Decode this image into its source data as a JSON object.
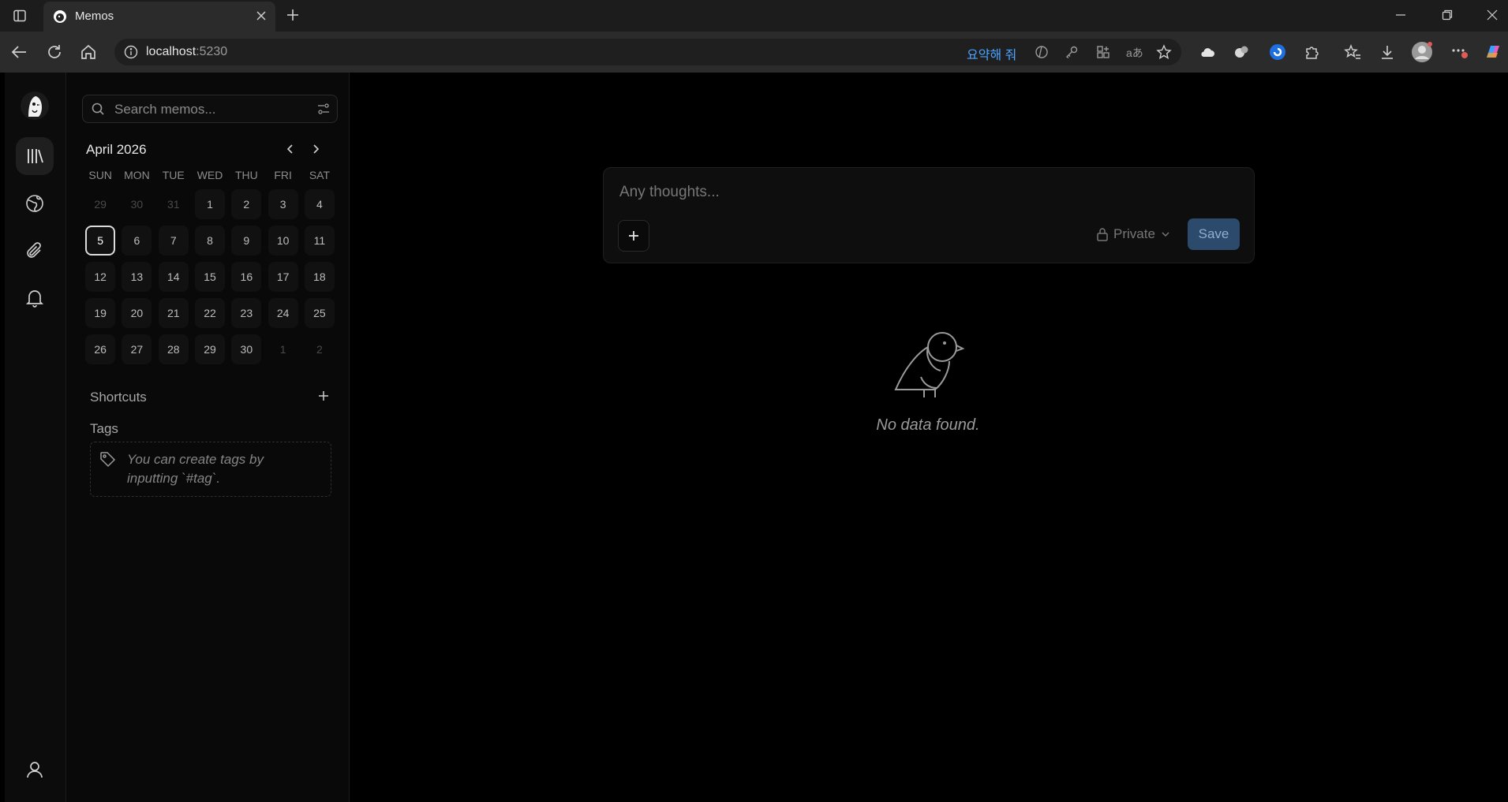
{
  "browser": {
    "tab_title": "Memos",
    "url_host": "localhost",
    "url_port": ":5230",
    "summarize_label": "요약해 줘"
  },
  "sidebar": {
    "search_placeholder": "Search memos...",
    "calendar": {
      "month_label": "April 2026",
      "weekdays": [
        "SUN",
        "MON",
        "TUE",
        "WED",
        "THU",
        "FRI",
        "SAT"
      ],
      "weeks": [
        [
          "29",
          "30",
          "31",
          "1",
          "2",
          "3",
          "4"
        ],
        [
          "5",
          "6",
          "7",
          "8",
          "9",
          "10",
          "11"
        ],
        [
          "12",
          "13",
          "14",
          "15",
          "16",
          "17",
          "18"
        ],
        [
          "19",
          "20",
          "21",
          "22",
          "23",
          "24",
          "25"
        ],
        [
          "26",
          "27",
          "28",
          "29",
          "30",
          "1",
          "2"
        ]
      ],
      "today": "5"
    },
    "shortcuts_label": "Shortcuts",
    "tags_label": "Tags",
    "tags_hint": "You can create tags by inputting `#tag`."
  },
  "editor": {
    "placeholder": "Any thoughts...",
    "visibility": "Private",
    "save_label": "Save"
  },
  "empty_state": {
    "text": "No data found."
  },
  "colors": {
    "accent": "#2b4a6c",
    "link": "#4aa3ff"
  }
}
